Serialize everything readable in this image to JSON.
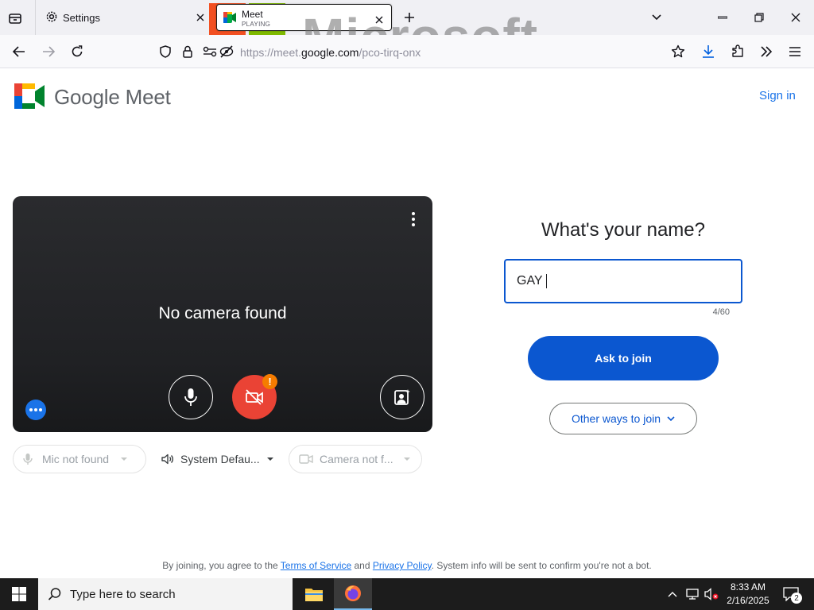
{
  "browser": {
    "tabs": [
      {
        "label": "Settings"
      },
      {
        "label": "Meet",
        "status": "PLAYING"
      }
    ],
    "url": {
      "prefix": "https://meet.",
      "domain": "google.com",
      "path": "/pco-tirq-onx"
    },
    "overlay_text": "Microsoft"
  },
  "header": {
    "product_name": "Google Meet",
    "sign_in_label": "Sign in"
  },
  "preview": {
    "message": "No camera found"
  },
  "join_panel": {
    "heading": "What's your name?",
    "name_value": "GAY",
    "char_counter": "4/60",
    "ask_to_join_label": "Ask to join",
    "other_ways_label": "Other ways to join"
  },
  "devices": {
    "mic_label": "Mic not found",
    "speaker_label": "System Defau...",
    "camera_label": "Camera not f..."
  },
  "footer": {
    "prefix": "By joining, you agree to the ",
    "terms_label": "Terms of Service",
    "and": " and ",
    "privacy_label": "Privacy Policy",
    "suffix": ". System info will be sent to confirm you're not a bot."
  },
  "taskbar": {
    "search_placeholder": "Type here to search",
    "time": "8:33 AM",
    "date": "2/16/2025",
    "notification_count": "2"
  },
  "colors": {
    "accent_blue": "#0b57d0",
    "link_blue": "#1a73e8",
    "danger_red": "#ea4335",
    "warning_orange": "#f57c00",
    "dark_bg": "#202124"
  }
}
